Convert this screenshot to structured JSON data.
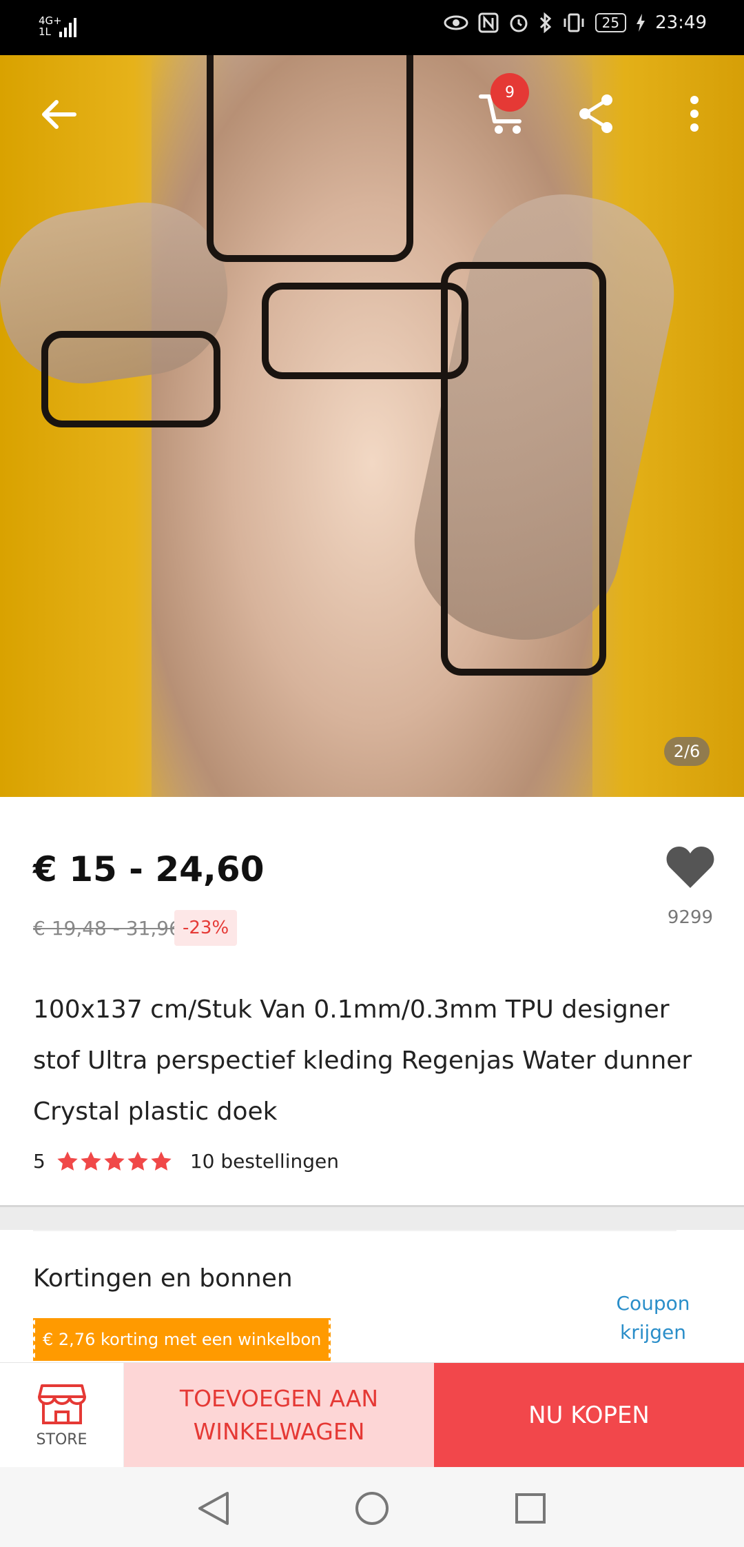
{
  "status_bar": {
    "network": "4G+",
    "network_sub": "1L",
    "battery": "25",
    "time": "23:49"
  },
  "header": {
    "cart_count": "9"
  },
  "gallery": {
    "indicator": "2/6"
  },
  "product": {
    "price": "€ 15 - 24,60",
    "original_price": "€ 19,48 - 31,96",
    "discount": "-23%",
    "wishlist_count": "9299",
    "title": "100x137 cm/Stuk Van 0.1mm/0.3mm TPU designer stof Ultra perspectief kleding Regenjas Water dunner Crystal plastic doek",
    "rating": "5",
    "stars": 5,
    "orders": "10 bestellingen"
  },
  "coupons": {
    "title": "Kortingen en bonnen",
    "chip": "€ 2,76 korting met een winkelbon",
    "link": "Coupon krijgen"
  },
  "bottom_bar": {
    "store_label": "STORE",
    "add_to_cart": "TOEVOEGEN AAN WINKELWAGEN",
    "buy_now": "NU KOPEN"
  },
  "colors": {
    "accent_red": "#e53935",
    "buy_bg": "#f2474b",
    "add_cart_bg": "#fdd6d6",
    "coupon_orange": "#ff9a00",
    "link_blue": "#2a8ec9"
  }
}
